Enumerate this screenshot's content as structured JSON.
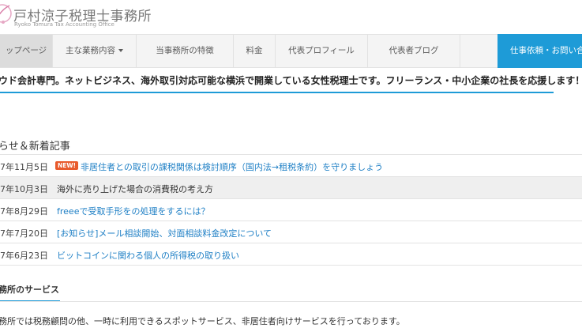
{
  "header": {
    "title": "戸村涼子税理士事務所",
    "subtitle": "Ryoko Tomura Tax Accounting Office"
  },
  "nav": {
    "items": [
      {
        "label": "ップページ"
      },
      {
        "label": "主な業務内容"
      },
      {
        "label": "当事務所の特徴"
      },
      {
        "label": "料金"
      },
      {
        "label": "代表プロフィール"
      },
      {
        "label": "代表者ブログ"
      }
    ],
    "contact_label": "仕事依頼・お問い合わせ"
  },
  "tagline": "ウド会計専門。ネットビジネス、海外取引対応可能な横浜で開業している女性税理士です。フリーランス・中小企業の社長を応援します！",
  "news": {
    "heading": "らせ＆新着記事",
    "items": [
      {
        "date": "7年11月5日",
        "badge": "NEW!",
        "title": "非居住者との取引の課税関係は検討順序（国内法→租税条約）を守りましょう"
      },
      {
        "date": "7年10月3日",
        "title": "海外に売り上げた場合の消費税の考え方"
      },
      {
        "date": "7年8月29日",
        "title": "freeeで受取手形をの処理をするには？"
      },
      {
        "date": "7年7月20日",
        "title": "[お知らせ]メール相談開始、対面相談料金改定について"
      },
      {
        "date": "7年6月23日",
        "title": "ビットコインに関わる個人の所得税の取り扱い"
      }
    ]
  },
  "services": {
    "heading": "務所のサービス",
    "text": "務所では税務顧問の他、一時に利用できるスポットサービス、非居住者向けサービスを行っております。"
  },
  "colors": {
    "accent": "#1e9bd7",
    "badge": "#e85a2c",
    "link": "#1e7fc5"
  }
}
